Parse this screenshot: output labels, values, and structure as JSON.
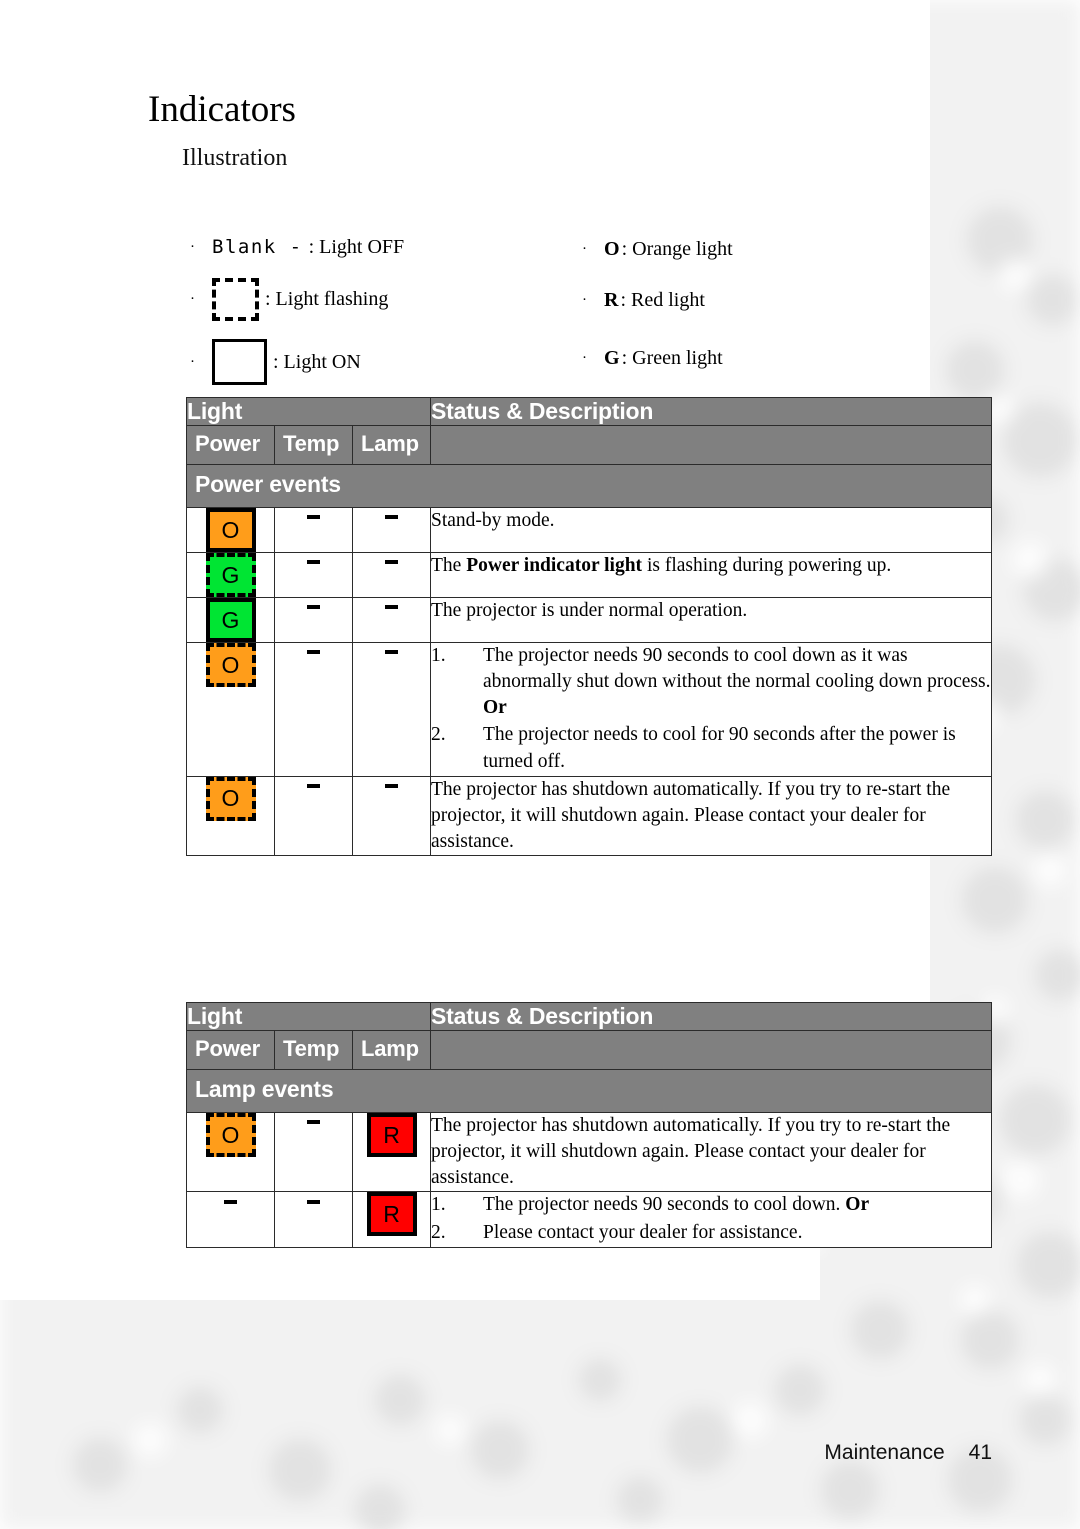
{
  "document": {
    "title": "Indicators",
    "section": "Illustration",
    "footer": {
      "chapter": "Maintenance",
      "page_number": "41"
    }
  },
  "legend": {
    "left": [
      {
        "icon": "blank-dash-icon",
        "symbol_text": "Blank -",
        "label": ": Light OFF"
      },
      {
        "icon": "dashed-square-icon",
        "symbol_text": "",
        "label": ": Light flashing"
      },
      {
        "icon": "solid-square-icon",
        "symbol_text": "",
        "label": ": Light ON"
      }
    ],
    "right": [
      {
        "icon": "letter-o-icon",
        "letter": "O",
        "label": ": Orange light"
      },
      {
        "icon": "letter-r-icon",
        "letter": "R",
        "label": ": Red light"
      },
      {
        "icon": "letter-g-icon",
        "letter": "G",
        "label": ": Green light"
      }
    ]
  },
  "colors": {
    "header_gray": "#808080",
    "orange": "#FF9D1A",
    "green": "#00E533",
    "red": "#FF0000",
    "border": "#2b2b2b"
  },
  "tables": [
    {
      "id": "power",
      "group_header": "Light",
      "desc_header": "Status & Description",
      "columns": [
        "Power",
        "Temp",
        "Lamp"
      ],
      "events_title": "Power events",
      "rows": [
        {
          "power": {
            "state": "solid",
            "color": "orange",
            "letter": "O"
          },
          "temp": {
            "state": "off",
            "letter": "-"
          },
          "lamp": {
            "state": "off",
            "letter": "-"
          },
          "description": {
            "type": "plain",
            "text": "Stand-by mode."
          }
        },
        {
          "power": {
            "state": "dashed",
            "color": "green",
            "letter": "G"
          },
          "temp": {
            "state": "off",
            "letter": "-"
          },
          "lamp": {
            "state": "off",
            "letter": "-"
          },
          "description": {
            "type": "rich",
            "prefix": "The ",
            "bold": "Power indicator light",
            "suffix": " is flashing during powering up."
          }
        },
        {
          "power": {
            "state": "solid",
            "color": "green",
            "letter": "G"
          },
          "temp": {
            "state": "off",
            "letter": "-"
          },
          "lamp": {
            "state": "off",
            "letter": "-"
          },
          "description": {
            "type": "plain",
            "text": "The projector is under normal operation."
          }
        },
        {
          "power": {
            "state": "dashed",
            "color": "orange",
            "letter": "O"
          },
          "temp": {
            "state": "off",
            "letter": "-"
          },
          "lamp": {
            "state": "off",
            "letter": "-"
          },
          "description": {
            "type": "list",
            "items": [
              {
                "num": "1.",
                "text": "The projector needs 90 seconds to cool down as it was abnormally shut down without the normal cooling down process. ",
                "bold_tail": "Or"
              },
              {
                "num": "2.",
                "text": "The projector needs to cool for 90 seconds after the power is turned off.",
                "bold_tail": ""
              }
            ]
          }
        },
        {
          "power": {
            "state": "dashed",
            "color": "orange",
            "letter": "O"
          },
          "temp": {
            "state": "off",
            "letter": "-"
          },
          "lamp": {
            "state": "off",
            "letter": "-"
          },
          "description": {
            "type": "plain",
            "text": "The projector has shutdown automatically. If you try to re-start the projector, it will shutdown again. Please contact your dealer for assistance."
          }
        }
      ]
    },
    {
      "id": "lamp",
      "group_header": "Light",
      "desc_header": "Status & Description",
      "columns": [
        "Power",
        "Temp",
        "Lamp"
      ],
      "events_title": "Lamp events",
      "rows": [
        {
          "power": {
            "state": "dashed",
            "color": "orange",
            "letter": "O"
          },
          "temp": {
            "state": "off",
            "letter": "-"
          },
          "lamp": {
            "state": "solid",
            "color": "red",
            "letter": "R"
          },
          "description": {
            "type": "plain",
            "text": "The projector has shutdown automatically. If you try to re-start the projector, it will shutdown again. Please contact your dealer for assistance."
          }
        },
        {
          "power": {
            "state": "off",
            "letter": "-"
          },
          "temp": {
            "state": "off",
            "letter": "-"
          },
          "lamp": {
            "state": "solid",
            "color": "red",
            "letter": "R"
          },
          "description": {
            "type": "list",
            "items": [
              {
                "num": "1.",
                "text": "The projector needs 90 seconds to cool down. ",
                "bold_tail": "Or"
              },
              {
                "num": "2.",
                "text": "Please contact your dealer for assistance.",
                "bold_tail": ""
              }
            ]
          }
        }
      ]
    }
  ]
}
